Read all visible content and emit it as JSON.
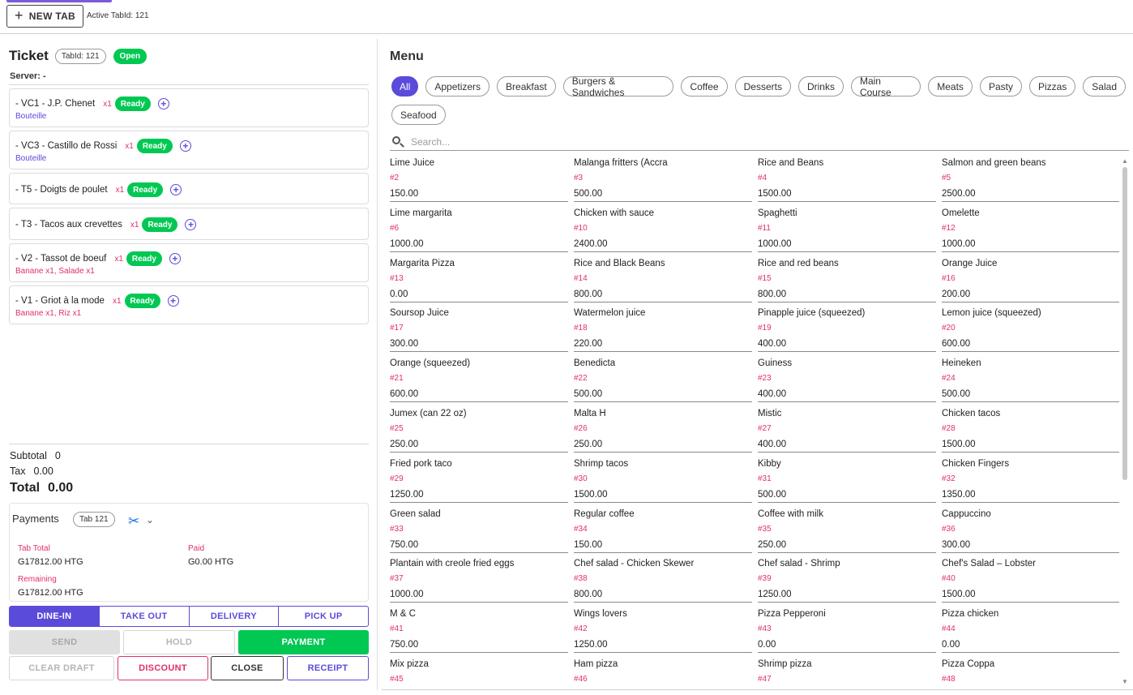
{
  "topbar": {
    "new_tab_label": "NEW TAB",
    "active_tab_text": "Active TabId: 121"
  },
  "ticket": {
    "title": "Ticket",
    "tabid_chip": "TabId: 121",
    "status": "Open",
    "server_label": "Server:",
    "server_value": "-",
    "items": [
      {
        "name": "- VC1 - J.P. Chenet",
        "qty": "x1",
        "status": "Ready",
        "sub": "Bouteille",
        "sub_color": "blue"
      },
      {
        "name": "- VC3 - Castillo de Rossi",
        "qty": "x1",
        "status": "Ready",
        "sub": "Bouteille",
        "sub_color": "blue"
      },
      {
        "name": "- T5 - Doigts de poulet",
        "qty": "x1",
        "status": "Ready",
        "sub": "",
        "sub_color": ""
      },
      {
        "name": "- T3 - Tacos aux crevettes",
        "qty": "x1",
        "status": "Ready",
        "sub": "",
        "sub_color": ""
      },
      {
        "name": "- V2 - Tassot de boeuf",
        "qty": "x1",
        "status": "Ready",
        "sub": "Banane x1, Salade x1",
        "sub_color": "pink"
      },
      {
        "name": "- V1 - Griot à la mode",
        "qty": "x1",
        "status": "Ready",
        "sub": "Banane x1, Riz x1",
        "sub_color": "pink"
      }
    ]
  },
  "totals": {
    "subtotal_label": "Subtotal",
    "subtotal_value": "0",
    "tax_label": "Tax",
    "tax_value": "0.00",
    "total_label": "Total",
    "total_value": "0.00"
  },
  "payments": {
    "title": "Payments",
    "tab_chip": "Tab 121",
    "tab_total_label": "Tab Total",
    "tab_total_value": "G17812.00 HTG",
    "paid_label": "Paid",
    "paid_value": "G0.00 HTG",
    "remaining_label": "Remaining",
    "remaining_value": "G17812.00 HTG"
  },
  "order_types": [
    "DINE-IN",
    "TAKE OUT",
    "DELIVERY",
    "PICK UP"
  ],
  "actions": {
    "send": "SEND",
    "hold": "HOLD",
    "payment": "PAYMENT",
    "clear_draft": "CLEAR DRAFT",
    "discount": "DISCOUNT",
    "close": "CLOSE",
    "receipt": "RECEIPT"
  },
  "menu": {
    "title": "Menu",
    "categories": [
      "All",
      "Appetizers",
      "Breakfast",
      "Burgers & Sandwiches",
      "Coffee",
      "Desserts",
      "Drinks",
      "Main Course",
      "Meats",
      "Pasty",
      "Pizzas",
      "Salad",
      "Seafood"
    ],
    "search_placeholder": "Search...",
    "items": [
      {
        "name": "Lime Juice",
        "id": "#2",
        "price": "150.00"
      },
      {
        "name": "Malanga fritters (Accra",
        "id": "#3",
        "price": "500.00"
      },
      {
        "name": "Rice and Beans",
        "id": "#4",
        "price": "1500.00"
      },
      {
        "name": "Salmon and green beans",
        "id": "#5",
        "price": "2500.00"
      },
      {
        "name": "Lime margarita",
        "id": "#6",
        "price": "1000.00"
      },
      {
        "name": "Chicken with sauce",
        "id": "#10",
        "price": "2400.00"
      },
      {
        "name": "Spaghetti",
        "id": "#11",
        "price": "1000.00"
      },
      {
        "name": "Omelette",
        "id": "#12",
        "price": "1000.00"
      },
      {
        "name": "Margarita Pizza",
        "id": "#13",
        "price": "0.00"
      },
      {
        "name": "Rice and Black Beans",
        "id": "#14",
        "price": "800.00"
      },
      {
        "name": "Rice and red beans",
        "id": "#15",
        "price": "800.00"
      },
      {
        "name": "Orange Juice",
        "id": "#16",
        "price": "200.00"
      },
      {
        "name": "Soursop Juice",
        "id": "#17",
        "price": "300.00"
      },
      {
        "name": "Watermelon juice",
        "id": "#18",
        "price": "220.00"
      },
      {
        "name": "Pinapple juice (squeezed)",
        "id": "#19",
        "price": "400.00"
      },
      {
        "name": "Lemon juice (squeezed)",
        "id": "#20",
        "price": "600.00"
      },
      {
        "name": "Orange (squeezed)",
        "id": "#21",
        "price": "600.00"
      },
      {
        "name": "Benedicta",
        "id": "#22",
        "price": "500.00"
      },
      {
        "name": "Guiness",
        "id": "#23",
        "price": "400.00"
      },
      {
        "name": "Heineken",
        "id": "#24",
        "price": "500.00"
      },
      {
        "name": "Jumex (can 22 oz)",
        "id": "#25",
        "price": "250.00"
      },
      {
        "name": "Malta H",
        "id": "#26",
        "price": "250.00"
      },
      {
        "name": "Mistic",
        "id": "#27",
        "price": "400.00"
      },
      {
        "name": "Chicken tacos",
        "id": "#28",
        "price": "1500.00"
      },
      {
        "name": "Fried pork taco",
        "id": "#29",
        "price": "1250.00"
      },
      {
        "name": "Shrimp tacos",
        "id": "#30",
        "price": "1500.00"
      },
      {
        "name": "Kibby",
        "id": "#31",
        "price": "500.00"
      },
      {
        "name": "Chicken Fingers",
        "id": "#32",
        "price": "1350.00"
      },
      {
        "name": "Green salad",
        "id": "#33",
        "price": "750.00"
      },
      {
        "name": "Regular coffee",
        "id": "#34",
        "price": "150.00"
      },
      {
        "name": "Coffee with milk",
        "id": "#35",
        "price": "250.00"
      },
      {
        "name": "Cappuccino",
        "id": "#36",
        "price": "300.00"
      },
      {
        "name": "Plantain with creole fried eggs",
        "id": "#37",
        "price": "1000.00"
      },
      {
        "name": "Chef salad - Chicken Skewer",
        "id": "#38",
        "price": "800.00"
      },
      {
        "name": "Chef salad - Shrimp",
        "id": "#39",
        "price": "1250.00"
      },
      {
        "name": "Chef's Salad – Lobster",
        "id": "#40",
        "price": "1500.00"
      },
      {
        "name": "M & C",
        "id": "#41",
        "price": "750.00"
      },
      {
        "name": "Wings lovers",
        "id": "#42",
        "price": "1250.00"
      },
      {
        "name": "Pizza Pepperoni",
        "id": "#43",
        "price": "0.00"
      },
      {
        "name": "Pizza chicken",
        "id": "#44",
        "price": "0.00"
      },
      {
        "name": "Mix pizza",
        "id": "#45",
        "price": ""
      },
      {
        "name": "Ham pizza",
        "id": "#46",
        "price": ""
      },
      {
        "name": "Shrimp pizza",
        "id": "#47",
        "price": ""
      },
      {
        "name": "Pizza Coppa",
        "id": "#48",
        "price": ""
      }
    ]
  },
  "colors": {
    "accent": "#5b4bdb",
    "success": "#00c853",
    "danger": "#e0306a"
  },
  "icons": [
    "plus-icon",
    "add-circle-icon",
    "scissors-icon",
    "chevron-down-icon",
    "search-icon"
  ]
}
